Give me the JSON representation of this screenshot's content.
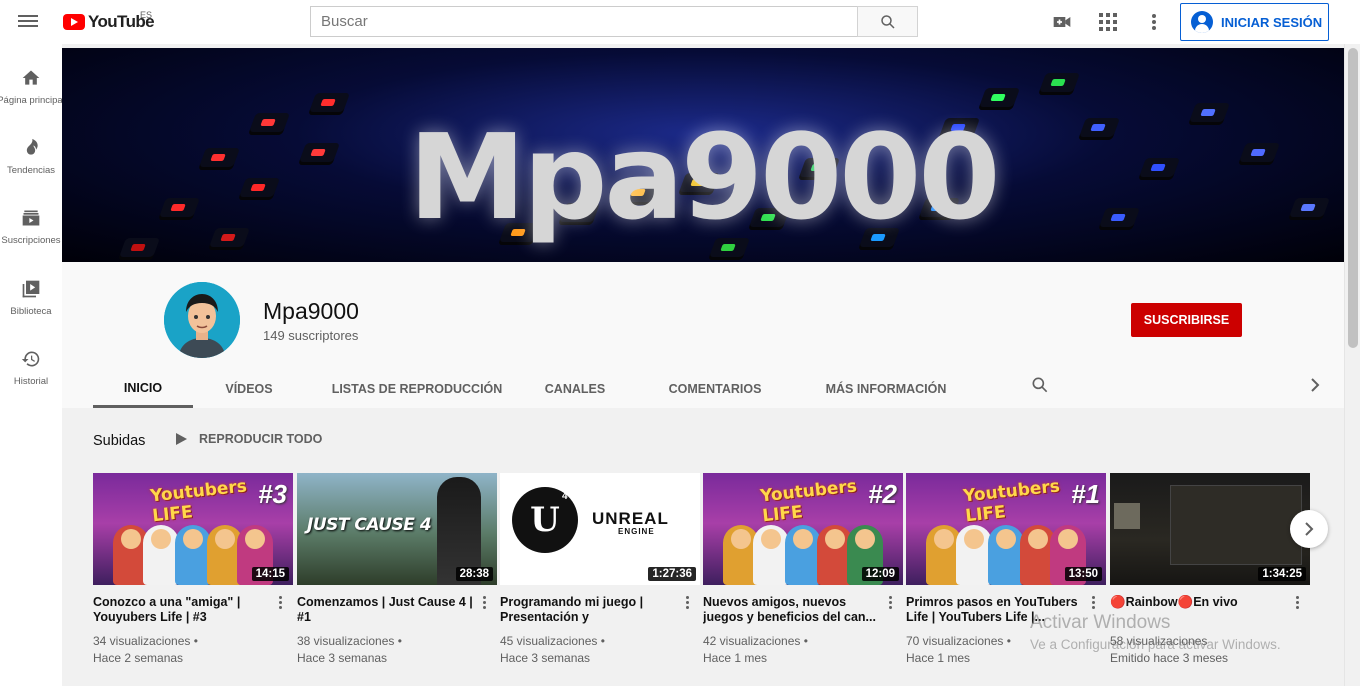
{
  "header": {
    "logo_text": "YouTube",
    "region": "ES",
    "search_placeholder": "Buscar",
    "signin_label": "INICIAR SESIÓN"
  },
  "sidebar": {
    "items": [
      {
        "label": "Página principal",
        "icon": "home-icon"
      },
      {
        "label": "Tendencias",
        "icon": "flame-icon"
      },
      {
        "label": "Suscripciones",
        "icon": "subscriptions-icon"
      },
      {
        "label": "Biblioteca",
        "icon": "library-icon"
      },
      {
        "label": "Historial",
        "icon": "history-icon"
      }
    ]
  },
  "banner": {
    "title": "Mpa9000"
  },
  "channel": {
    "name": "Mpa9000",
    "subscribers": "149 suscriptores",
    "subscribe_label": "SUSCRIBIRSE",
    "tabs": [
      {
        "label": "INICIO",
        "active": true
      },
      {
        "label": "VÍDEOS",
        "active": false
      },
      {
        "label": "LISTAS DE REPRODUCCIÓN",
        "active": false
      },
      {
        "label": "CANALES",
        "active": false
      },
      {
        "label": "COMENTARIOS",
        "active": false
      },
      {
        "label": "MÁS INFORMACIÓN",
        "active": false
      }
    ]
  },
  "shelf": {
    "title": "Subidas",
    "play_all": "REPRODUCIR TODO",
    "videos": [
      {
        "title": "Conozco a una \"amiga\" | Youyubers Life | #3",
        "duration": "14:15",
        "views": "34 visualizaciones •",
        "age": "Hace 2 semanas",
        "thumb_logo": "Youtubers LIFE",
        "thumb_tag": "#3"
      },
      {
        "title": "Comenzamos | Just Cause 4 | #1",
        "duration": "28:38",
        "views": "38 visualizaciones •",
        "age": "Hace 3 semanas",
        "thumb_logo": "JUST CAUSE 4"
      },
      {
        "title": "Programando mi juego | Presentación y programació...",
        "duration": "1:27:36",
        "views": "45 visualizaciones •",
        "age": "Hace 3 semanas",
        "thumb_logo": "UNREAL",
        "thumb_sub": "ENGINE"
      },
      {
        "title": "Nuevos amigos, nuevos juegos y beneficios del can...",
        "duration": "12:09",
        "views": "42 visualizaciones •",
        "age": "Hace 1 mes",
        "thumb_logo": "Youtubers LIFE",
        "thumb_tag": "#2"
      },
      {
        "title": "Primros pasos en YouTubers Life | YouTubers Life |...",
        "duration": "13:50",
        "views": "70 visualizaciones •",
        "age": "Hace 1 mes",
        "thumb_logo": "Youtubers LIFE",
        "thumb_tag": "#1"
      },
      {
        "title": "🔴Rainbow🔴En vivo",
        "duration": "1:34:25",
        "views": "58 visualizaciones",
        "age": "Emitido hace 3 meses"
      }
    ]
  },
  "overlay": {
    "activate_title": "Activar Windows",
    "activate_sub": "Ve a Configuración para activar Windows."
  },
  "colors": {
    "brand_red": "#ff0000",
    "subscribe_red": "#cc0000",
    "link_blue": "#065fd4"
  }
}
